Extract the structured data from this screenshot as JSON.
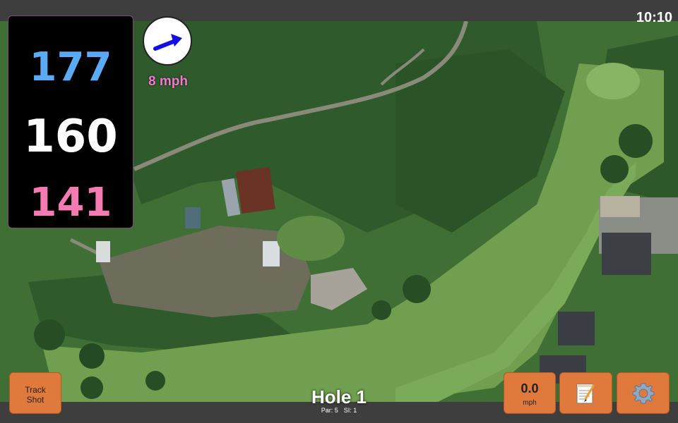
{
  "status": {
    "clock": "10:10"
  },
  "yardages": {
    "back": "177",
    "middle": "160",
    "front": "141"
  },
  "wind": {
    "label": "8 mph",
    "icon": "wind-arrow-icon",
    "color": "#f07ad0"
  },
  "buttons": {
    "track_shot_line1": "Track",
    "track_shot_line2": "Shot",
    "speed_value": "0.0",
    "speed_unit": "mph",
    "notes_icon": "notepad-icon",
    "settings_icon": "gear-icon"
  },
  "hole": {
    "title": "Hole 1",
    "par": "Par: 5",
    "si": "SI: 1"
  },
  "colors": {
    "button": "#e07a3c",
    "back": "#5aaaf5",
    "middle": "#ffffff",
    "front": "#f47ab4",
    "bar": "#3e3e3e"
  }
}
